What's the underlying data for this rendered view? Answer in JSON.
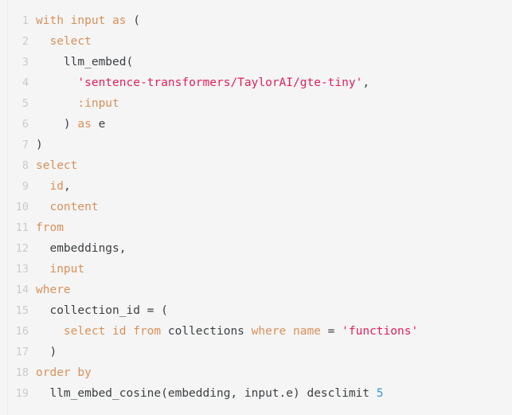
{
  "editor": {
    "name": "sql-code-editor",
    "language": "sql",
    "background_color": "#f5f5f5",
    "gutter_color": "#c9cbcb",
    "colors": {
      "keyword": "#d99058",
      "string": "#e0205a",
      "number": "#2f9bd8",
      "plain": "#3c4043"
    },
    "line_count": 19,
    "lines": [
      {
        "number": "1",
        "tokens": [
          {
            "text": "with input as ",
            "type": "keyword"
          },
          {
            "text": "(",
            "type": "plain"
          }
        ]
      },
      {
        "number": "2",
        "tokens": [
          {
            "text": "  ",
            "type": "plain"
          },
          {
            "text": "select",
            "type": "keyword"
          }
        ]
      },
      {
        "number": "3",
        "tokens": [
          {
            "text": "    llm_embed(",
            "type": "plain"
          }
        ]
      },
      {
        "number": "4",
        "tokens": [
          {
            "text": "      ",
            "type": "plain"
          },
          {
            "text": "'sentence-transformers/TaylorAI/gte-tiny'",
            "type": "string"
          },
          {
            "text": ",",
            "type": "plain"
          }
        ]
      },
      {
        "number": "5",
        "tokens": [
          {
            "text": "      ",
            "type": "plain"
          },
          {
            "text": ":input",
            "type": "keyword"
          }
        ]
      },
      {
        "number": "6",
        "tokens": [
          {
            "text": "    )",
            "type": "plain"
          },
          {
            "text": " as ",
            "type": "keyword"
          },
          {
            "text": "e",
            "type": "plain"
          }
        ]
      },
      {
        "number": "7",
        "tokens": [
          {
            "text": ")",
            "type": "plain"
          }
        ]
      },
      {
        "number": "8",
        "tokens": [
          {
            "text": "select",
            "type": "keyword"
          }
        ]
      },
      {
        "number": "9",
        "tokens": [
          {
            "text": "  ",
            "type": "plain"
          },
          {
            "text": "id",
            "type": "keyword"
          },
          {
            "text": ",",
            "type": "plain"
          }
        ]
      },
      {
        "number": "10",
        "tokens": [
          {
            "text": "  ",
            "type": "plain"
          },
          {
            "text": "content",
            "type": "keyword"
          }
        ]
      },
      {
        "number": "11",
        "tokens": [
          {
            "text": "from",
            "type": "keyword"
          }
        ]
      },
      {
        "number": "12",
        "tokens": [
          {
            "text": "  embeddings,",
            "type": "plain"
          }
        ]
      },
      {
        "number": "13",
        "tokens": [
          {
            "text": "  ",
            "type": "plain"
          },
          {
            "text": "input",
            "type": "keyword"
          }
        ]
      },
      {
        "number": "14",
        "tokens": [
          {
            "text": "where",
            "type": "keyword"
          }
        ]
      },
      {
        "number": "15",
        "tokens": [
          {
            "text": "  collection_id = (",
            "type": "plain"
          }
        ]
      },
      {
        "number": "16",
        "tokens": [
          {
            "text": "    ",
            "type": "plain"
          },
          {
            "text": "select id from ",
            "type": "keyword"
          },
          {
            "text": "collections ",
            "type": "plain"
          },
          {
            "text": "where name ",
            "type": "keyword"
          },
          {
            "text": "= ",
            "type": "plain"
          },
          {
            "text": "'functions'",
            "type": "string"
          }
        ]
      },
      {
        "number": "17",
        "tokens": [
          {
            "text": "  )",
            "type": "plain"
          }
        ]
      },
      {
        "number": "18",
        "tokens": [
          {
            "text": "order by",
            "type": "keyword"
          }
        ]
      },
      {
        "number": "19",
        "tokens": [
          {
            "text": "  llm_embed_cosine(embedding, input.e) desclimit ",
            "type": "plain"
          },
          {
            "text": "5",
            "type": "number"
          }
        ]
      }
    ]
  }
}
